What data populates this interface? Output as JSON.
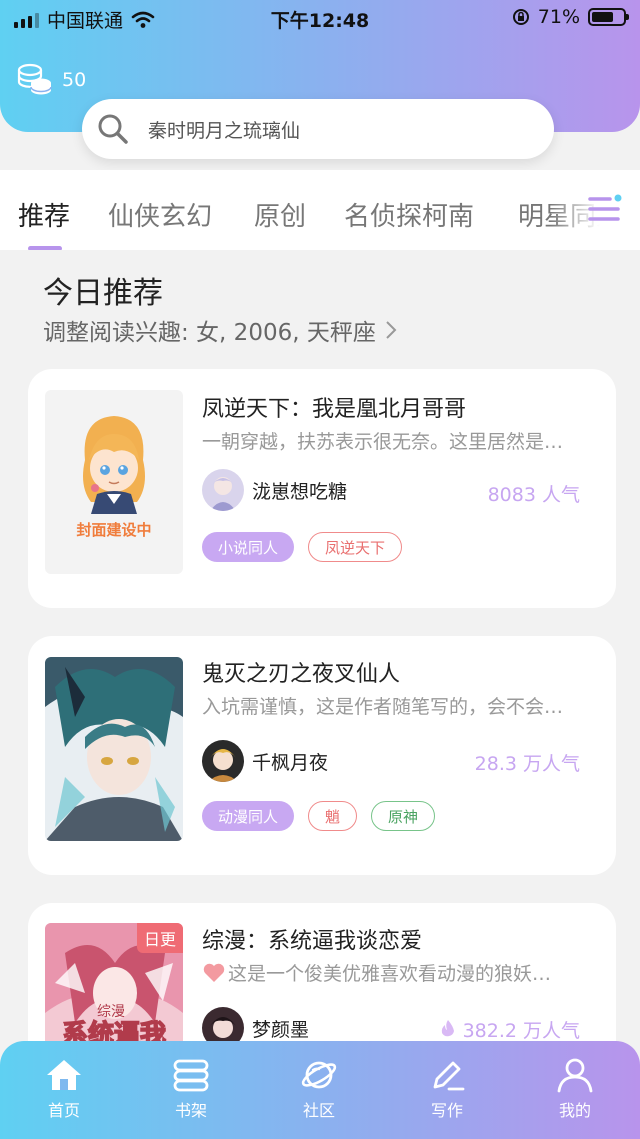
{
  "status_bar": {
    "carrier": "中国联通",
    "time": "下午12:48",
    "battery": "71%"
  },
  "header": {
    "coin_count": "50",
    "search_placeholder": "秦时明月之琉璃仙"
  },
  "tabs": [
    {
      "label": "推荐",
      "active": true
    },
    {
      "label": "仙侠玄幻"
    },
    {
      "label": "原创"
    },
    {
      "label": "名侦探柯南"
    },
    {
      "label": "明星同人"
    }
  ],
  "section": {
    "title": "今日推荐",
    "subtitle": "调整阅读兴趣: 女, 2006, 天秤座"
  },
  "books": [
    {
      "title": "凤逆天下：我是凰北月哥哥",
      "desc": "一朝穿越，扶苏表示很无奈。这里居然是…",
      "author": "泷崽想吃糖",
      "popularity": "8083 人气",
      "cover_caption": "封面建设中",
      "tags": [
        "小说同人",
        "凤逆天下"
      ]
    },
    {
      "title": "鬼灭之刃之夜叉仙人",
      "desc": "入坑需谨慎，这是作者随笔写的，会不会…",
      "author": "千枫月夜",
      "popularity": "28.3 万人气",
      "tags": [
        "动漫同人",
        "魈",
        "原神"
      ]
    },
    {
      "title": "综漫：系统逼我谈恋爱",
      "desc": "这是一个俊美优雅喜欢看动漫的狼妖…",
      "author": "梦颜墨",
      "popularity": "382.2 万人气",
      "badge": "日更",
      "cover_text": "系统逼我",
      "cover_small": "综漫"
    }
  ],
  "bottom_nav": [
    {
      "label": "首页",
      "icon": "home-icon",
      "active": true
    },
    {
      "label": "书架",
      "icon": "bookshelf-icon"
    },
    {
      "label": "社区",
      "icon": "planet-icon"
    },
    {
      "label": "写作",
      "icon": "pen-icon"
    },
    {
      "label": "我的",
      "icon": "user-icon"
    }
  ],
  "colors": {
    "accent": "#b794ec",
    "gradient_start": "#5fd0f2",
    "gradient_end": "#b894ec",
    "popularity": "#c7a6f1"
  }
}
